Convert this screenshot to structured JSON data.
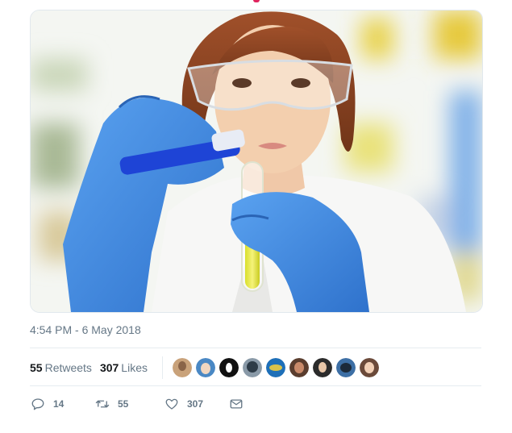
{
  "tweet": {
    "timestamp": "4:54 PM - 6 May 2018",
    "image_alt": "Scientist in lab coat, safety glasses and blue gloves pouring blue liquid into a test tube of yellow liquid"
  },
  "stats": {
    "retweets_count": "55",
    "retweets_label": "Retweets",
    "likes_count": "307",
    "likes_label": "Likes"
  },
  "liked_by_avatars": [
    {
      "name": "liker-avatar-1",
      "color": "#c9a27a"
    },
    {
      "name": "liker-avatar-2",
      "color": "#4a88c4"
    },
    {
      "name": "liker-avatar-3",
      "color": "#111111"
    },
    {
      "name": "liker-avatar-4",
      "color": "#8a9aa8"
    },
    {
      "name": "liker-avatar-5",
      "color": "#1e6fb8"
    },
    {
      "name": "liker-avatar-6",
      "color": "#5a3d2e"
    },
    {
      "name": "liker-avatar-7",
      "color": "#2b2b2b"
    },
    {
      "name": "liker-avatar-8",
      "color": "#3d6fa5"
    },
    {
      "name": "liker-avatar-9",
      "color": "#6b4a3a"
    }
  ],
  "actions": {
    "reply_count": "14",
    "retweet_count": "55",
    "like_count": "307"
  },
  "icons": {
    "reply": "reply-icon",
    "retweet": "retweet-icon",
    "like": "heart-icon",
    "dm": "envelope-icon"
  },
  "colors": {
    "muted": "#657786",
    "text": "#14171a",
    "border": "#e6ecf0",
    "glove_blue": "#3d86e0"
  }
}
